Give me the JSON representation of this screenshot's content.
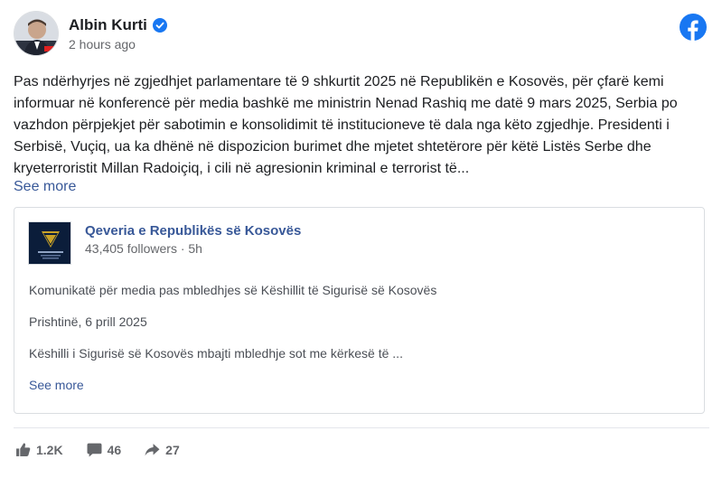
{
  "post": {
    "author": "Albin Kurti",
    "timestamp": "2 hours ago",
    "text": "Pas ndërhyrjes në zgjedhjet parlamentare të 9 shkurtit 2025 në Republikën e Kosovës, për çfarë kemi informuar në konferencë për media bashkë me ministrin Nenad Rashiq me datë 9 mars 2025, Serbia po vazhdon përpjekjet për sabotimin e konsolidimit të institucioneve të dala nga këto zgjedhje. Presidenti i Serbisë, Vuçiq, ua ka dhënë në dispozicion burimet dhe mjetet shtetërore për këtë Listës Serbe dhe kryeterroristit Millan Radoiçiq, i cili në agresionin kriminal e terrorist të...",
    "see_more": "See more"
  },
  "shared": {
    "page_name": "Qeveria e Republikës së Kosovës",
    "page_meta": "43,405 followers · 5h",
    "line1": "Komunikatë për media pas mbledhjes së Këshillit të Sigurisë së Kosovës",
    "line2": "Prishtinë, 6 prill 2025",
    "line3": "Këshilli i Sigurisë së Kosovës mbajti mbledhje sot me kërkesë të ...",
    "see_more": "See more"
  },
  "stats": {
    "likes": "1.2K",
    "comments": "46",
    "shares": "27"
  },
  "colors": {
    "facebook_blue": "#1877f2",
    "link_blue": "#385898",
    "muted": "#65676b"
  },
  "icons": [
    "verified-badge-icon",
    "facebook-logo-icon",
    "like-icon",
    "comment-icon",
    "share-icon"
  ]
}
